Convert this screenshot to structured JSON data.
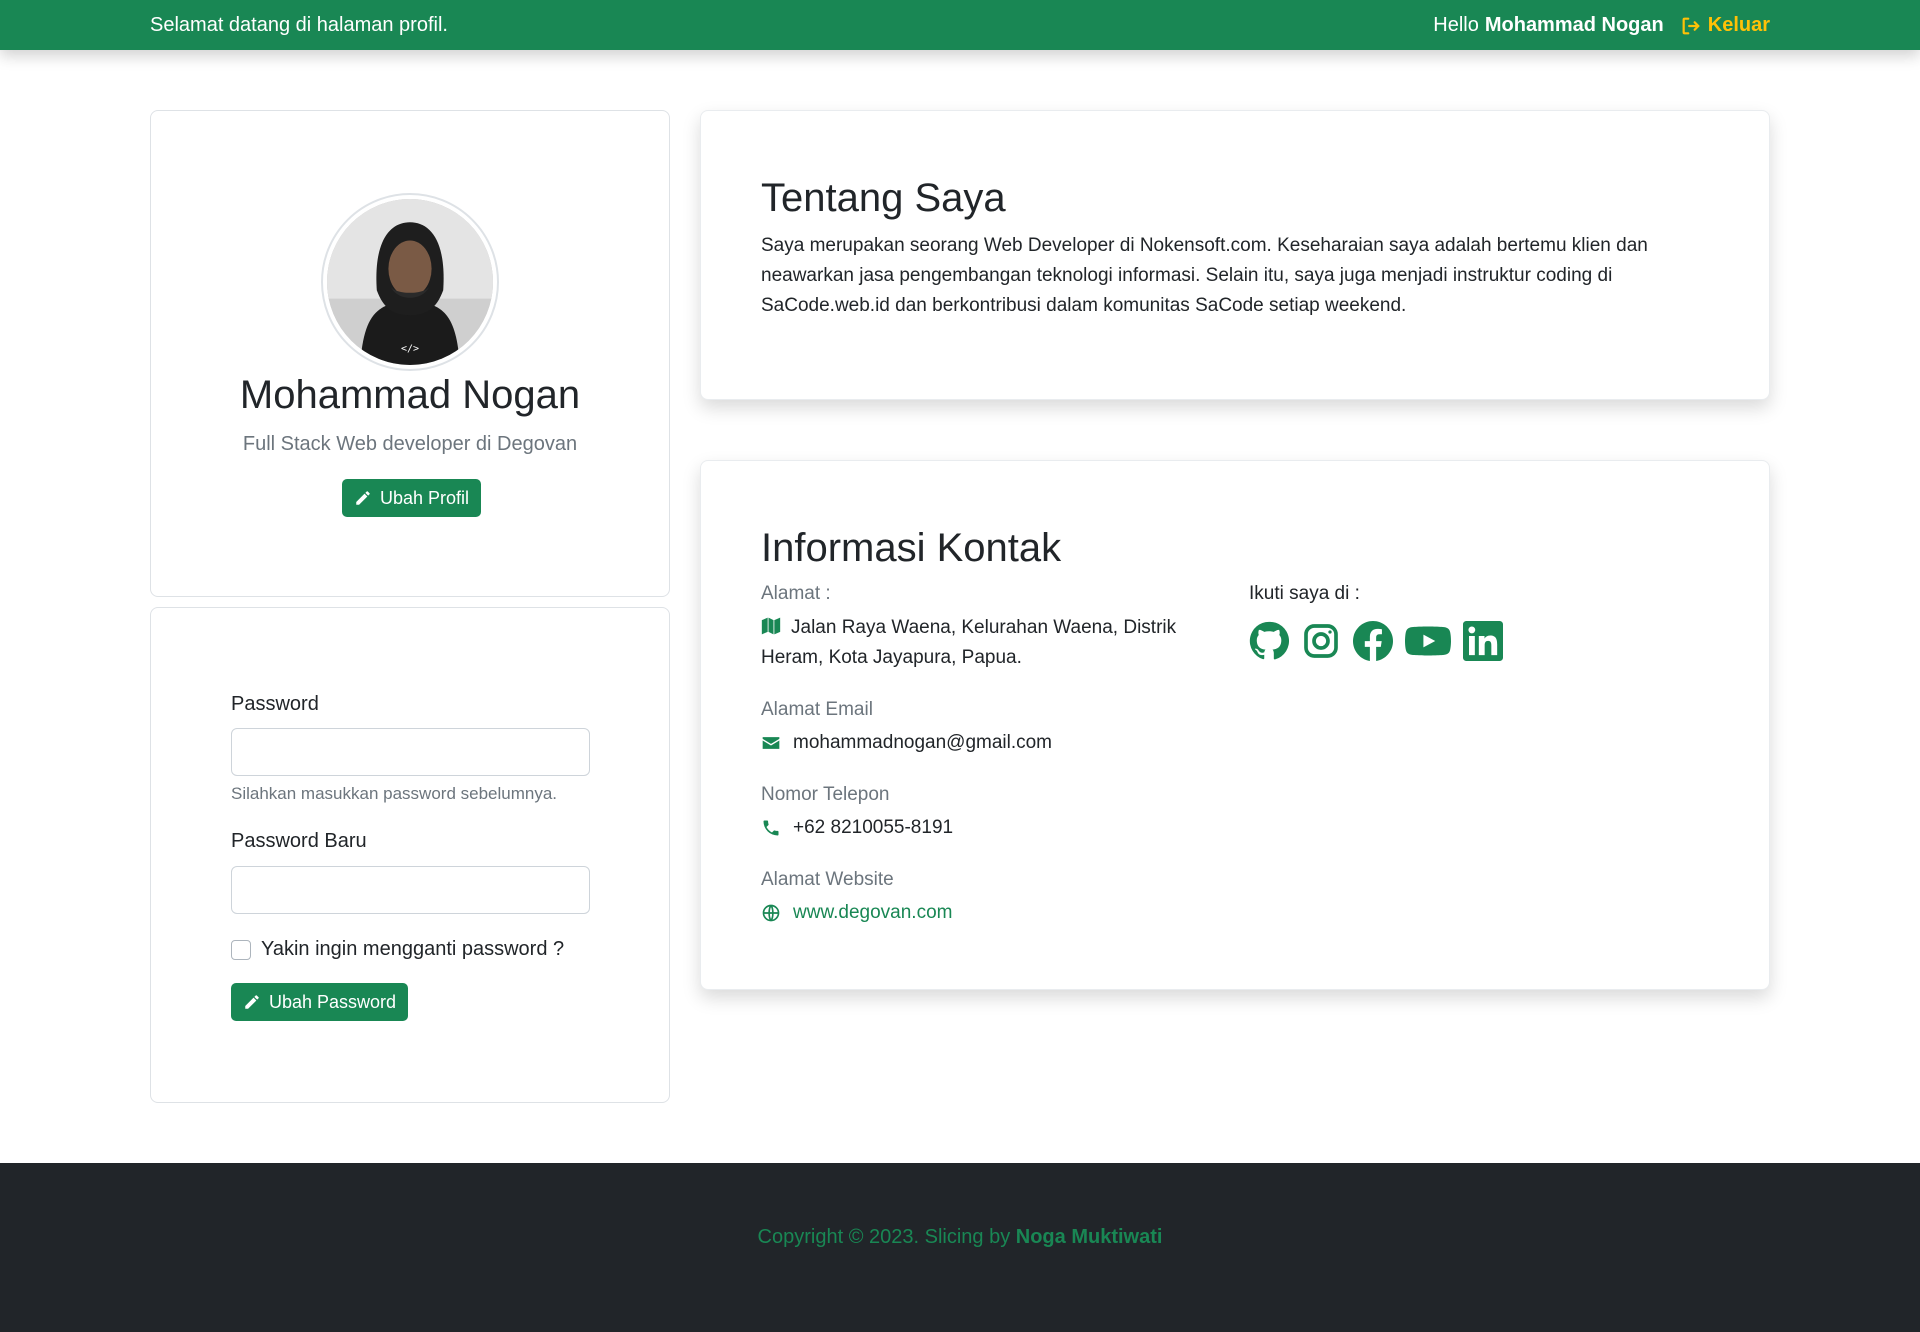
{
  "topbar": {
    "welcome": "Selamat datang di halaman profil.",
    "greeting": "Hello",
    "user_name": "Mohammad Nogan",
    "logout_label": "Keluar"
  },
  "profile": {
    "name": "Mohammad Nogan",
    "role": "Full Stack Web developer di Degovan",
    "edit_label": "Ubah Profil"
  },
  "password_form": {
    "password_label": "Password",
    "password_value": "",
    "password_help": "Silahkan masukkan password sebelumnya.",
    "new_password_label": "Password Baru",
    "new_password_value": "",
    "confirm_label": "Yakin ingin mengganti password ?",
    "confirm_checked": false,
    "submit_label": "Ubah Password"
  },
  "about": {
    "title": "Tentang Saya",
    "text": "Saya merupakan seorang Web Developer di Nokensoft.com. Keseharaian saya adalah bertemu klien dan neawarkan jasa pengembangan teknologi informasi. Selain itu, saya juga menjadi instruktur coding di SaCode.web.id dan berkontribusi dalam komunitas SaCode setiap weekend."
  },
  "contact": {
    "title": "Informasi Kontak",
    "address_label": "Alamat :",
    "address_value": "Jalan Raya Waena, Kelurahan Waena, Distrik Heram, Kota Jayapura, Papua.",
    "email_label": "Alamat Email",
    "email_value": "mohammadnogan@gmail.com",
    "phone_label": "Nomor Telepon",
    "phone_value": "+62 8210055-8191",
    "website_label": "Alamat Website",
    "website_value": "www.degovan.com",
    "follow_label": "Ikuti saya di :",
    "social_icons": [
      "github-icon",
      "instagram-icon",
      "facebook-icon",
      "youtube-icon",
      "linkedin-icon"
    ]
  },
  "footer": {
    "prefix": "Copyright © 2023. Slicing by",
    "author": "Noga Muktiwati"
  },
  "colors": {
    "primary": "#198754",
    "warning": "#ffc107",
    "footer_bg": "#212529"
  }
}
